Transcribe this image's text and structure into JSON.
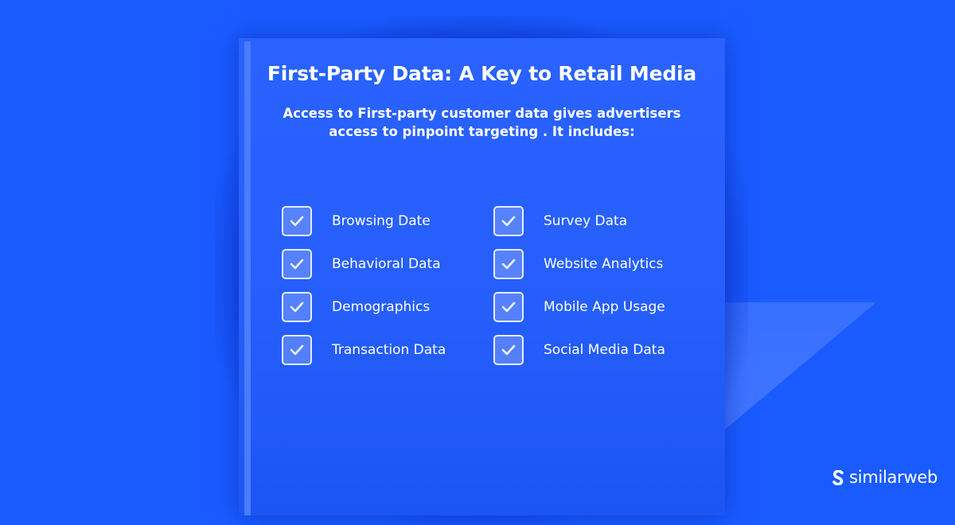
{
  "header": {
    "title": "First-Party Data: A Key to Retail Media",
    "subtitle_line1": "Access to First-party customer data gives advertisers",
    "subtitle_line2": "access to pinpoint targeting .  It includes:"
  },
  "checklist": {
    "left": [
      {
        "label": "Browsing Date",
        "checked": true,
        "icon": "check-icon"
      },
      {
        "label": "Behavioral Data",
        "checked": true,
        "icon": "check-icon"
      },
      {
        "label": "Demographics",
        "checked": true,
        "icon": "check-icon"
      },
      {
        "label": "Transaction Data",
        "checked": true,
        "icon": "check-icon"
      }
    ],
    "right": [
      {
        "label": "Survey Data",
        "checked": true,
        "icon": "check-icon"
      },
      {
        "label": "Website Analytics",
        "checked": true,
        "icon": "check-icon"
      },
      {
        "label": "Mobile App Usage",
        "checked": true,
        "icon": "check-icon"
      },
      {
        "label": "Social Media Data",
        "checked": true,
        "icon": "check-icon"
      }
    ]
  },
  "brand": {
    "name": "similarweb",
    "icon": "similarweb-logo-icon"
  },
  "colors": {
    "background": "#1a5bff",
    "card": "#2962ff",
    "text": "#ffffff"
  }
}
